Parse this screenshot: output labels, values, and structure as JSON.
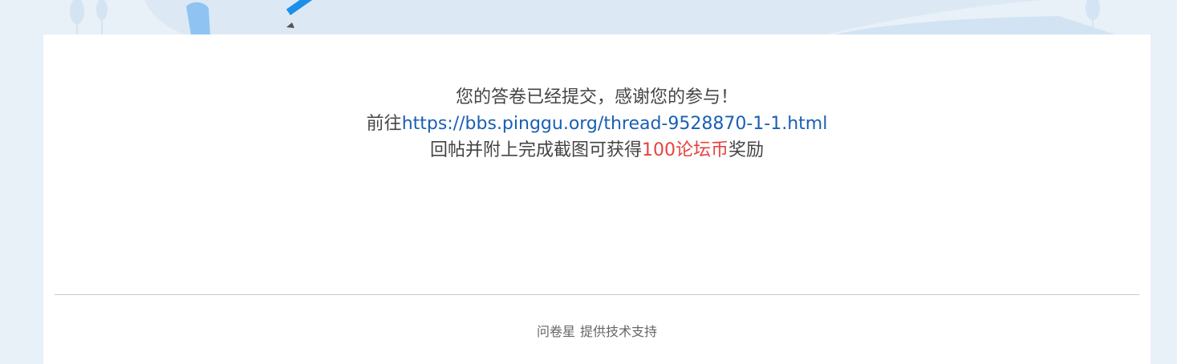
{
  "message": {
    "line1": "您的答卷已经提交，感谢您的参与！",
    "line2_prefix": "前往",
    "line2_link": "https://bbs.pinggu.org/thread-9528870-1-1.html",
    "line3_prefix": "回帖并附上完成截图可获得",
    "line3_highlight": "100论坛币",
    "line3_suffix": "奖励"
  },
  "footer": {
    "brand": "问卷星",
    "text": "提供技术支持"
  },
  "colors": {
    "link": "#1a5fb4",
    "highlight": "#e64340",
    "page_background": "#e8f0f8"
  }
}
